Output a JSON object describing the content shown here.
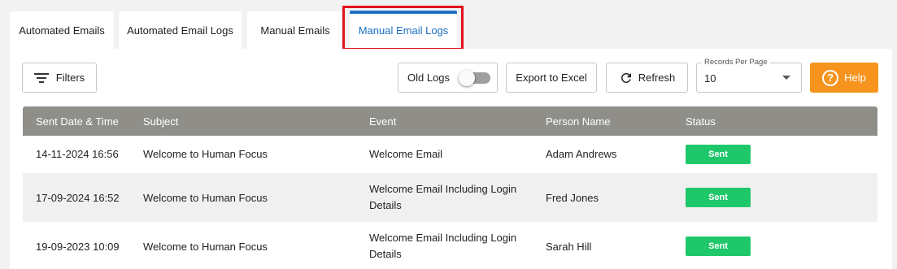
{
  "tabs": [
    {
      "label": "Automated Emails"
    },
    {
      "label": "Automated Email Logs"
    },
    {
      "label": "Manual Emails"
    },
    {
      "label": "Manual Email Logs",
      "active": true
    }
  ],
  "toolbar": {
    "filters_label": "Filters",
    "old_logs_label": "Old Logs",
    "old_logs_enabled": false,
    "export_label": "Export to Excel",
    "refresh_label": "Refresh",
    "records_per_page_label": "Records Per Page",
    "records_per_page_value": "10",
    "help_label": "Help",
    "help_icon_glyph": "?"
  },
  "table": {
    "columns": [
      "Sent Date & Time",
      "Subject",
      "Event",
      "Person Name",
      "Status"
    ],
    "rows": [
      {
        "sent": "14-11-2024 16:56",
        "subject": "Welcome to Human Focus",
        "event": "Welcome Email",
        "person": "Adam Andrews",
        "status": "Sent"
      },
      {
        "sent": "17-09-2024 16:52",
        "subject": "Welcome to Human Focus",
        "event": "Welcome Email Including Login Details",
        "person": "Fred Jones",
        "status": "Sent"
      },
      {
        "sent": "19-09-2023 10:09",
        "subject": "Welcome to Human Focus",
        "event": "Welcome Email Including Login Details",
        "person": "Sarah Hill",
        "status": "Sent"
      }
    ]
  },
  "colors": {
    "accent": "#1c6fc4",
    "highlight": "#e0121c",
    "help": "#f7941d",
    "status_sent": "#1ec86a",
    "table_header": "#8f8e89"
  },
  "icons": {
    "filters": "filter-lines-icon",
    "refresh": "refresh-icon",
    "help": "question-circle-icon",
    "dropdown": "caret-down-icon"
  }
}
